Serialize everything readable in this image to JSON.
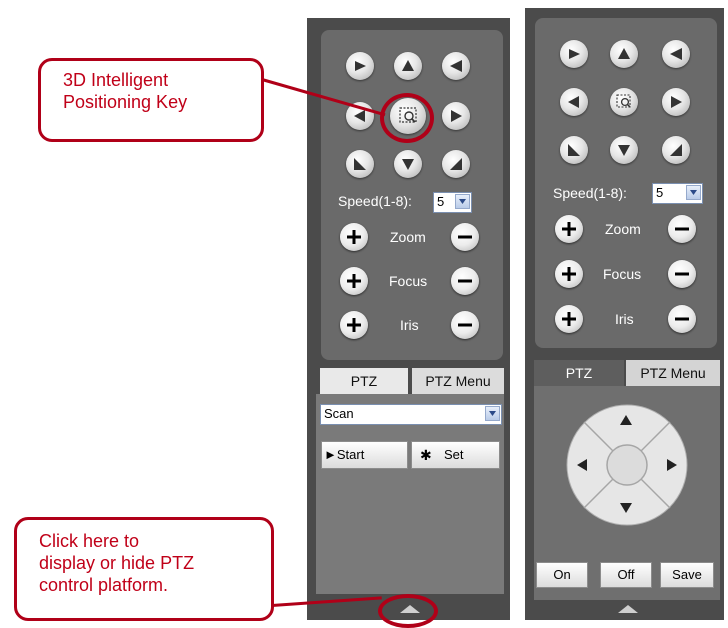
{
  "annotations": {
    "positioning_key_text": [
      "3D Intelligent",
      "Positioning Key"
    ],
    "toggle_text": [
      "Click here to",
      "display or hide PTZ",
      "control platform."
    ]
  },
  "left_panel": {
    "speed_label": "Speed(1-8):",
    "speed_value": "5",
    "zoom_label": "Zoom",
    "focus_label": "Focus",
    "iris_label": "Iris",
    "tabs": {
      "ptz": "PTZ",
      "ptz_menu": "PTZ Menu"
    },
    "active_tab": "PTZ",
    "mode_value": "Scan",
    "start_label": "►Start",
    "set_label": "Set"
  },
  "right_panel": {
    "speed_label": "Speed(1-8):",
    "speed_value": "5",
    "zoom_label": "Zoom",
    "focus_label": "Focus",
    "iris_label": "Iris",
    "tabs": {
      "ptz": "PTZ",
      "ptz_menu": "PTZ Menu"
    },
    "active_tab": "PTZ Menu",
    "on_label": "On",
    "off_label": "Off",
    "save_label": "Save"
  },
  "colors": {
    "panel_bg": "#4b4b4b",
    "box_bg": "#6a6a6a",
    "callout_red": "#b00018"
  }
}
